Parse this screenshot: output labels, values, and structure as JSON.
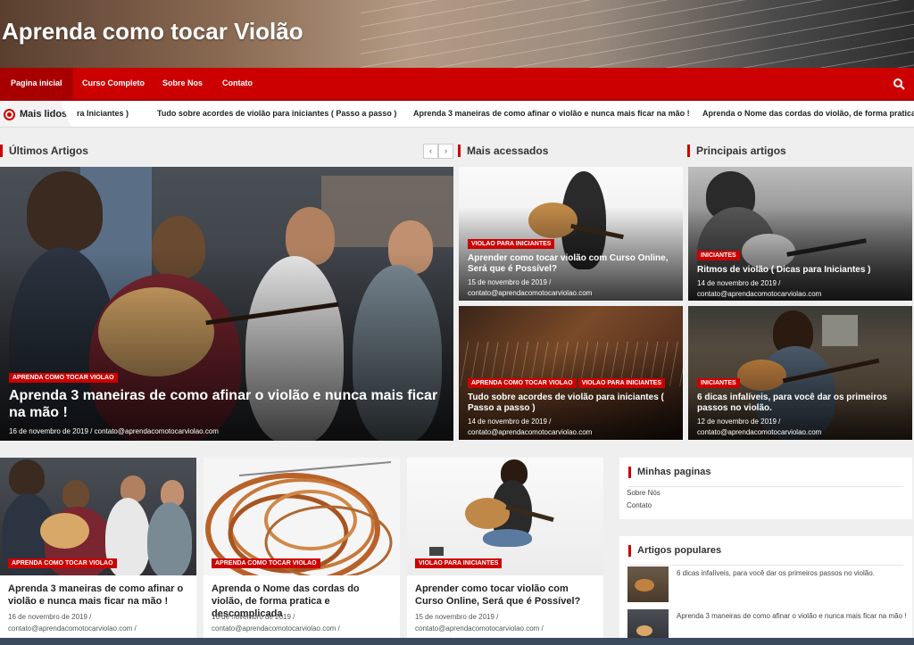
{
  "site_title": "Aprenda como tocar Violão",
  "nav": {
    "items": [
      "Pagina inicial",
      "Curso Completo",
      "Sobre Nos",
      "Contato"
    ]
  },
  "ticker": {
    "label": "Mais lidos",
    "items": [
      "ra Iniciantes )",
      "Tudo sobre acordes de violão para iniciantes ( Passo a passo )",
      "Aprenda 3 maneiras de como afinar o violão e nunca mais ficar na mão !",
      "Aprenda o Nome das cordas do violão, de forma pratica e"
    ]
  },
  "sections": {
    "ultimos": "Últimos Artigos",
    "mais_acessados": "Mais acessados",
    "principais": "Principais artigos"
  },
  "big": {
    "category": "APRENDA COMO TOCAR VIOLAO",
    "title": "Aprenda 3 maneiras de como afinar o violão e nunca mais ficar na mão !",
    "meta": "16 de novembro de 2019 / contato@aprendacomotocarviolao.com"
  },
  "mais": [
    {
      "cats": [
        "VIOLAO PARA INICIANTES"
      ],
      "title": "Aprender como tocar violão com Curso Online, Será que é Possível?",
      "date": "15 de novembro de 2019 /",
      "author": "contato@aprendacomotocarviolao.com"
    },
    {
      "cats": [
        "APRENDA COMO TOCAR VIOLAO",
        "VIOLAO PARA INICIANTES"
      ],
      "title": "Tudo sobre acordes de violão para iniciantes ( Passo a passo )",
      "date": "14 de novembro de 2019 /",
      "author": "contato@aprendacomotocarviolao.com"
    }
  ],
  "principais": [
    {
      "cats": [
        "INICIANTES"
      ],
      "title": "Ritmos de violão ( Dicas para Iniciantes )",
      "date": "14 de novembro de 2019 /",
      "author": "contato@aprendacomotocarviolao.com"
    },
    {
      "cats": [
        "INICIANTES"
      ],
      "title": "6 dicas infalíveis, para você dar os primeiros passos no violão.",
      "date": "12 de novembro de 2019 /",
      "author": "contato@aprendacomotocarviolao.com"
    }
  ],
  "tiles": [
    {
      "cat": "APRENDA COMO TOCAR VIOLAO",
      "title": "Aprenda 3 maneiras de como afinar o violão e nunca mais ficar na mão !",
      "date": "16 de novembro de 2019 /",
      "author": "contato@aprendacomotocarviolao.com /"
    },
    {
      "cat": "APRENDA COMO TOCAR VIOLAO",
      "title": "Aprenda o Nome das cordas do violão, de forma pratica e descomplicada",
      "date": "16 de novembro de 2019 /",
      "author": "contato@aprendacomotocarviolao.com /"
    },
    {
      "cat": "VIOLAO PARA INICIANTES",
      "title": "Aprender como tocar violão com Curso Online, Será que é Possível?",
      "date": "15 de novembro de 2019 /",
      "author": "contato@aprendacomotocarviolao.com /"
    }
  ],
  "sidebar": {
    "pages_title": "Minhas paginas",
    "pages": [
      "Sobre Nós",
      "Contato"
    ],
    "popular_title": "Artigos populares",
    "popular": [
      "6 dicas infalíveis, para você dar os primeiros passos no violão.",
      "Aprenda 3 maneiras de como afinar o violão e nunca mais ficar na mão !"
    ]
  },
  "colors": {
    "accent": "#cc0000",
    "accent_dark": "#a80000"
  }
}
